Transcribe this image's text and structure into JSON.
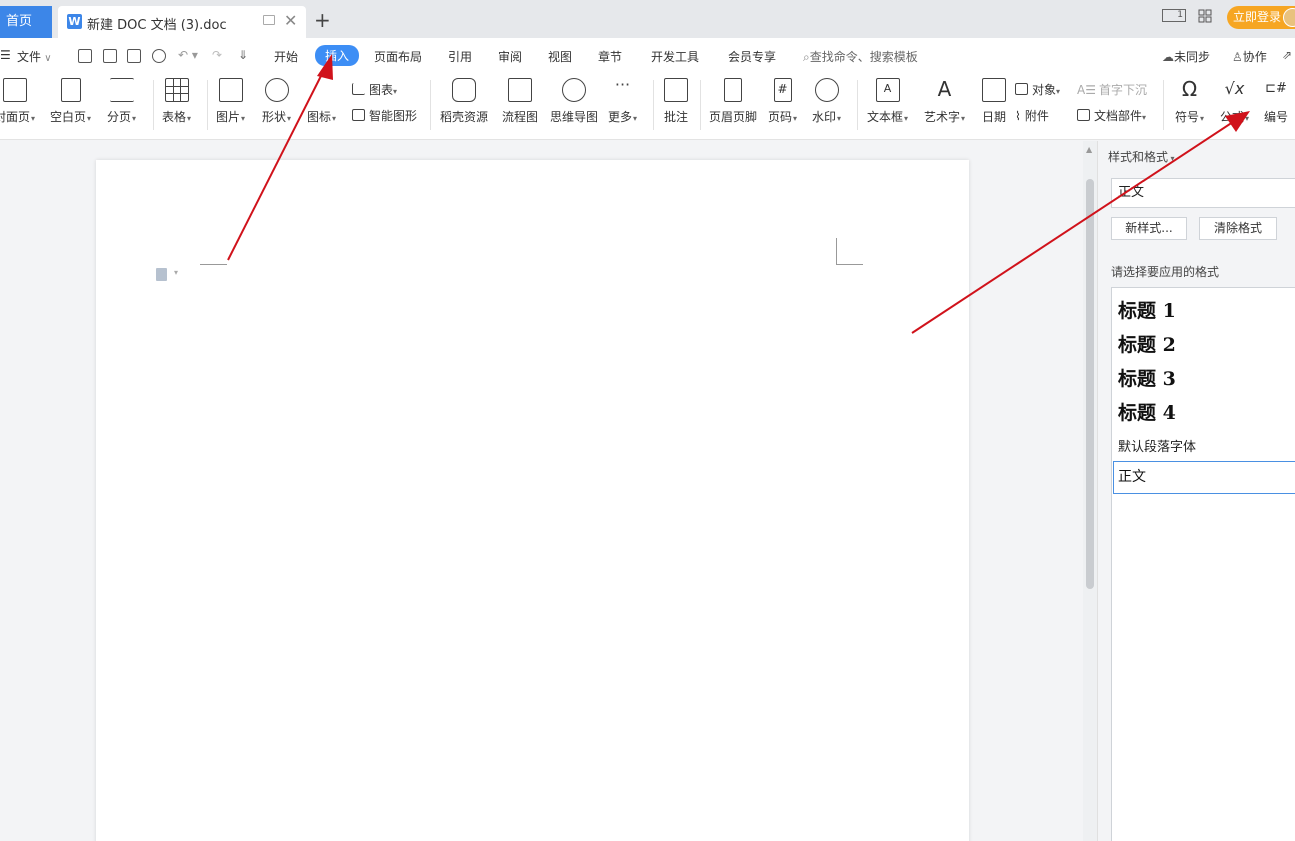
{
  "tabbar": {
    "home_label": "首页",
    "doc_title": "新建 DOC 文档 (3).doc",
    "add_symbol": "+",
    "close_symbol": "✕",
    "login_label": "立即登录",
    "layout_icon_text": "1"
  },
  "menubar": {
    "file_label": "文件",
    "items": [
      "开始",
      "插入",
      "页面布局",
      "引用",
      "审阅",
      "视图",
      "章节",
      "开发工具",
      "会员专享"
    ],
    "active": "插入",
    "search_placeholder": "查找命令、搜索模板",
    "sync_label": "未同步",
    "collab_label": "协作"
  },
  "ribbon": {
    "cover_page": "封面页",
    "blank_page": "空白页",
    "page_break": "分页",
    "table": "表格",
    "picture": "图片",
    "shape": "形状",
    "icon": "图标",
    "chart": "图表",
    "smart_art": "智能图形",
    "docer_resources": "稻壳资源",
    "flowchart": "流程图",
    "mind_map": "思维导图",
    "more": "更多",
    "comment": "批注",
    "header_footer": "页眉页脚",
    "page_number": "页码",
    "watermark": "水印",
    "text_box": "文本框",
    "word_art": "艺术字",
    "date": "日期",
    "object": "对象",
    "attachment": "附件",
    "drop_cap": "首字下沉",
    "doc_parts": "文档部件",
    "symbol": "符号",
    "formula": "公式",
    "numbering": "编号"
  },
  "panel": {
    "title": "样式和格式",
    "current_style": "正文",
    "new_style_button": "新样式...",
    "clear_format_button": "清除格式",
    "choose_label": "请选择要应用的格式",
    "styles": [
      {
        "name": "标题  1"
      },
      {
        "name": "标题  2"
      },
      {
        "name": "标题  3"
      },
      {
        "name": "标题  4"
      },
      {
        "name": "默认段落字体"
      },
      {
        "name": "正文"
      }
    ]
  },
  "annotations": {
    "arrow_color": "#d0121b"
  },
  "colors": {
    "accent": "#3d8ef5",
    "login": "#f6a623"
  }
}
